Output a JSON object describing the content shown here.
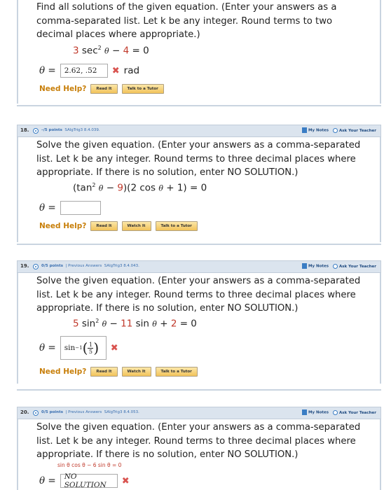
{
  "problems": [
    {
      "text": "Find all solutions of the given equation. (Enter your answers as a comma-separated list. Let k be any integer. Round terms to two decimal places where appropriate.)",
      "equation": {
        "coef1": "3",
        "mid": " sec",
        "sup": "2",
        "theta": "θ",
        "op": " − ",
        "coef2": "4",
        "rhs": " = 0"
      },
      "answer": {
        "label": "θ =",
        "value": "2.62, .52",
        "mark": "✖",
        "unit": "rad"
      },
      "help": {
        "label": "Need Help?",
        "buttons": [
          "Read It",
          "Talk to a Tutor"
        ]
      }
    },
    {
      "number": "18.",
      "points": "–/5 points",
      "id": "SAlgTrig3 8.4.039.",
      "my_notes": "My Notes",
      "ask_teacher": "Ask Your Teacher",
      "text": "Solve the given equation. (Enter your answers as a comma-separated list. Let k be any integer. Round terms to three decimal places where appropriate. If there is no solution, enter NO SOLUTION.)",
      "equation": {
        "a": "(tan",
        "sup": "2",
        "theta": "θ",
        "op": " − ",
        "c9": "9",
        "b": ")(2 cos ",
        "theta2": "θ",
        "tail": " + 1) = 0"
      },
      "answer": {
        "label": "θ =",
        "value": ""
      },
      "help": {
        "label": "Need Help?",
        "buttons": [
          "Read It",
          "Watch It",
          "Talk to a Tutor"
        ]
      }
    },
    {
      "number": "19.",
      "points": "0/5 points",
      "previous": "Previous Answers",
      "id": "SAlgTrig3 8.4.043.",
      "my_notes": "My Notes",
      "ask_teacher": "Ask Your Teacher",
      "text": "Solve the given equation. (Enter your answers as a comma-separated list. Let k be any integer. Round terms to three decimal places where appropriate. If there is no solution, enter NO SOLUTION.)",
      "equation": {
        "c5": "5",
        "a": " sin",
        "sup": "2",
        "theta": "θ",
        "op": " − ",
        "c11": "11",
        "b": " sin ",
        "theta2": "θ",
        "op2": " + ",
        "c2": "2",
        "rhs": " = 0"
      },
      "answer": {
        "label": "θ =",
        "fn": "sin",
        "sup": "−1",
        "num": "1",
        "den": "5",
        "mark": "✖"
      },
      "help": {
        "label": "Need Help?",
        "buttons": [
          "Read It",
          "Watch It",
          "Talk to a Tutor"
        ]
      }
    },
    {
      "number": "20.",
      "points": "0/5 points",
      "previous": "Previous Answers",
      "id": "SAlgTrig3 8.4.053.",
      "my_notes": "My Notes",
      "ask_teacher": "Ask Your Teacher",
      "text": "Solve the given equation. (Enter your answers as a comma-separated list. Let k be any integer. Round terms to three decimal places where appropriate. If there is no solution, enter NO SOLUTION.)",
      "equation": "sin θ cos θ − 6 sin θ = 0",
      "answer": {
        "label": "θ =",
        "value": "NO SOLUTION",
        "mark": "✖"
      }
    }
  ],
  "colors": {
    "coef": "#c0392b",
    "header_bg": "#dbe4ee",
    "need_help": "#c87f0a",
    "wrong": "#d9534f"
  }
}
